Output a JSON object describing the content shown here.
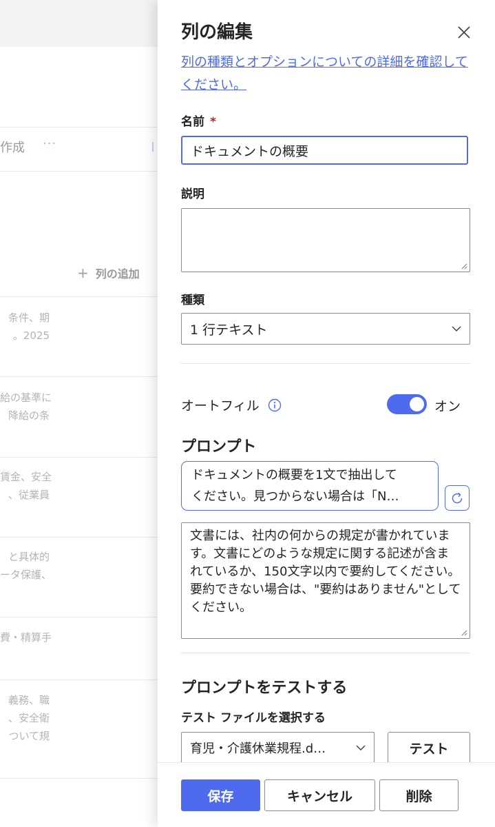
{
  "background": {
    "command_label": "作成",
    "more_label": "···",
    "add_column_label": "列の追加",
    "rows": [
      [
        "条件、期",
        "。2025"
      ],
      [
        "給の基準に",
        "降給の条"
      ],
      [
        "賃金、安全",
        "、従業員"
      ],
      [
        "と具体的",
        "ータ保護、"
      ],
      [
        "費・精算手"
      ],
      [
        "義務、職",
        "、安全衛",
        "ついて規"
      ]
    ]
  },
  "panel": {
    "title": "列の編集",
    "help_link": "列の種類とオプションについての詳細を確認してください。",
    "name_label": "名前",
    "required_mark": "*",
    "name_value": "ドキュメントの概要",
    "description_label": "説明",
    "description_value": "",
    "type_label": "種類",
    "type_value": "1 行テキスト",
    "autofill_label": "オートフィル",
    "autofill_state": "オン",
    "autofill_on": true,
    "prompt_heading": "プロンプト",
    "prompt_line1": "ドキュメントの概要を1文で抽出して",
    "prompt_line2": "ください。見つからない場合は「N…",
    "prompt_body": "文書には、社内の何からの規定が書かれています。文書にどのような規定に関する記述が含まれているか、150文字以内で要約してください。要約できない場合は、\"要約はありません\"としてください。",
    "test_heading": "プロンプトをテストする",
    "test_file_label": "テスト ファイルを選択する",
    "test_file_value": "育児・介護休業規程.d…",
    "test_button": "テスト",
    "save_button": "保存",
    "cancel_button": "キャンセル",
    "delete_button": "削除"
  },
  "colors": {
    "accent": "#4f6bed",
    "required": "#a4262c",
    "text": "#242424"
  },
  "icons": {
    "close": "close-icon",
    "info": "info-icon",
    "chevron": "chevron-down-icon",
    "refresh": "refresh-icon",
    "plus": "plus-icon"
  }
}
